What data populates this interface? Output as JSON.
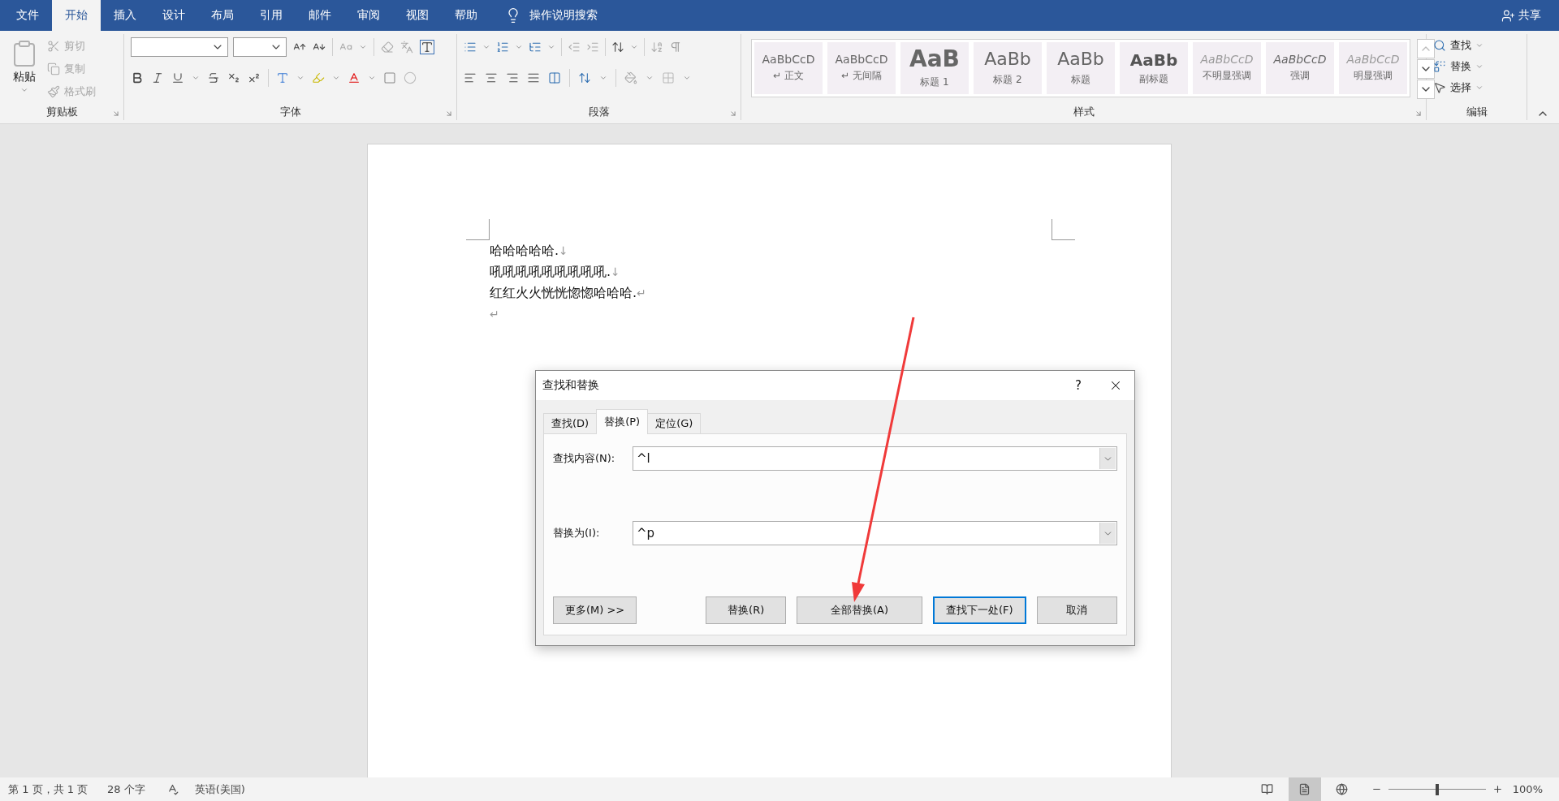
{
  "title_bar": {
    "tabs": [
      {
        "label": "文件",
        "selected": false
      },
      {
        "label": "开始",
        "selected": true
      },
      {
        "label": "插入",
        "selected": false
      },
      {
        "label": "设计",
        "selected": false
      },
      {
        "label": "布局",
        "selected": false
      },
      {
        "label": "引用",
        "selected": false
      },
      {
        "label": "邮件",
        "selected": false
      },
      {
        "label": "审阅",
        "selected": false
      },
      {
        "label": "视图",
        "selected": false
      },
      {
        "label": "帮助",
        "selected": false
      }
    ],
    "search_hint": "操作说明搜索",
    "share": "共享"
  },
  "ribbon": {
    "clipboard": {
      "label": "剪贴板",
      "paste": "粘贴",
      "items": [
        {
          "label": "剪切",
          "disabled": true
        },
        {
          "label": "复制",
          "disabled": true
        },
        {
          "label": "格式刷",
          "disabled": true
        }
      ]
    },
    "font": {
      "label": "字体"
    },
    "paragraph": {
      "label": "段落"
    },
    "styles": {
      "label": "样式",
      "items": [
        {
          "kind": "normal",
          "sample": "AaBbCcD",
          "name": "↵ 正文"
        },
        {
          "kind": "normal",
          "sample": "AaBbCcD",
          "name": "↵ 无间隔"
        },
        {
          "kind": "heading1",
          "sample": "AaB",
          "name": "标题 1"
        },
        {
          "kind": "heading2",
          "sample": "AaBb",
          "name": "标题 2"
        },
        {
          "kind": "title",
          "sample": "AaBb",
          "name": "标题"
        },
        {
          "kind": "subtitle",
          "sample": "AaBb",
          "name": "副标题"
        },
        {
          "kind": "subtle",
          "sample": "AaBbCcD",
          "name": "不明显强调"
        },
        {
          "kind": "emphasis",
          "sample": "AaBbCcD",
          "name": "强调"
        },
        {
          "kind": "subtle",
          "sample": "AaBbCcD",
          "name": "明显强调"
        }
      ]
    },
    "editing": {
      "label": "编辑",
      "items": [
        {
          "kind": "find",
          "label": "查找"
        },
        {
          "kind": "replace",
          "label": "替换"
        },
        {
          "kind": "select",
          "label": "选择"
        }
      ]
    }
  },
  "document": {
    "lines": [
      {
        "text": "哈哈哈哈哈.",
        "mark": "↓"
      },
      {
        "text": "吼吼吼吼吼吼吼吼吼.",
        "mark": "↓"
      },
      {
        "text": "红红火火恍恍惚惚哈哈哈.",
        "mark": "↵"
      },
      {
        "mark": "↵"
      }
    ]
  },
  "dialog": {
    "title": "查找和替换",
    "help": "?",
    "tabs": [
      {
        "label": "查找(D)",
        "selected": false
      },
      {
        "label": "替换(P)",
        "selected": true
      },
      {
        "label": "定位(G)",
        "selected": false
      }
    ],
    "fields": [
      {
        "label": "查找内容(N):",
        "value": "^l"
      },
      {
        "label": "替换为(I):",
        "value": "^p"
      }
    ],
    "more_button": "更多(M) >>",
    "buttons": [
      {
        "label": "替换(R)",
        "default": false
      },
      {
        "label": "全部替换(A)",
        "default": false
      },
      {
        "label": "查找下一处(F)",
        "default": true
      },
      {
        "label": "取消",
        "default": false
      }
    ]
  },
  "status_bar": {
    "page": "第 1 页，共 1 页",
    "words": "28 个字",
    "language": "英语(美国)",
    "views": [
      {
        "kind": "read",
        "selected": false
      },
      {
        "kind": "print",
        "selected": true
      },
      {
        "kind": "web",
        "selected": false
      }
    ],
    "zoom": {
      "level": 0.5,
      "reading": "100%"
    }
  }
}
